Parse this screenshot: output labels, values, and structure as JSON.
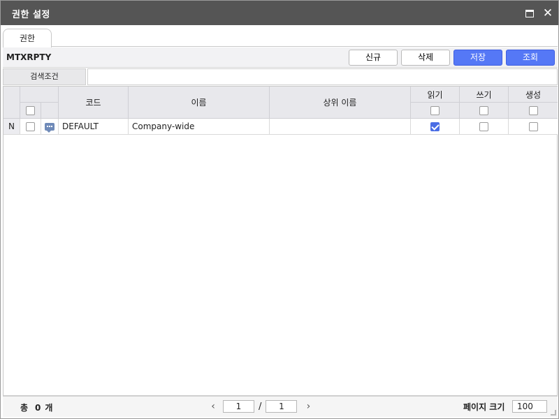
{
  "window": {
    "title": "권한 설정"
  },
  "tabs": [
    {
      "label": "권한"
    }
  ],
  "toolbar": {
    "code_label": "MTXRPTY",
    "new_label": "신규",
    "delete_label": "삭제",
    "save_label": "저장",
    "search_label": "조회"
  },
  "search": {
    "label": "검색조건",
    "value": ""
  },
  "grid": {
    "columns": {
      "code": "코드",
      "name": "이름",
      "parent_name": "상위 이름",
      "read": "읽기",
      "write": "쓰기",
      "create": "생성"
    },
    "rows": [
      {
        "status": "N",
        "checked": false,
        "memo_icon": "memo-icon",
        "code": "DEFAULT",
        "name": "Company-wide",
        "parent_name": "",
        "read": true,
        "write": false,
        "create": false
      }
    ]
  },
  "footer": {
    "total_prefix": "총",
    "total_count": "0",
    "total_suffix": "개",
    "current_page": "1",
    "page_separator": "/",
    "total_pages": "1",
    "page_size_label": "페이지 크기",
    "page_size": "100"
  },
  "colors": {
    "titlebar": "#555555",
    "primary_button": "#5578f6",
    "header_cell": "#e8e8ec",
    "checkbox_checked": "#4a6de5"
  }
}
